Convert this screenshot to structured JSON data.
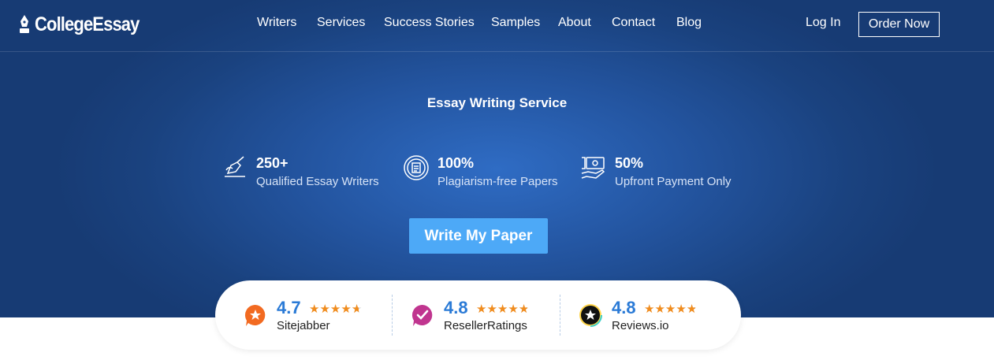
{
  "header": {
    "logo_text": "CollegeEssay",
    "nav": [
      "Writers",
      "Services",
      "Success Stories",
      "Samples",
      "About",
      "Contact",
      "Blog"
    ],
    "login_label": "Log In",
    "order_label": "Order Now"
  },
  "hero": {
    "title": "Essay Writing Service",
    "stats": [
      {
        "icon": "writing-hand-icon",
        "value": "250+",
        "label": "Qualified Essay Writers"
      },
      {
        "icon": "certified-document-icon",
        "value": "100%",
        "label": "Plagiarism-free Papers"
      },
      {
        "icon": "hand-money-icon",
        "value": "50%",
        "label": "Upfront Payment Only"
      }
    ],
    "cta_label": "Write My Paper"
  },
  "ratings": [
    {
      "score": "4.7",
      "stars": 4.7,
      "name": "Sitejabber",
      "icon": "sitejabber-icon",
      "color": "#f26a21"
    },
    {
      "score": "4.8",
      "stars": 4.8,
      "name": "ResellerRatings",
      "icon": "resellerratings-icon",
      "color": "#c0358f"
    },
    {
      "score": "4.8",
      "stars": 4.8,
      "name": "Reviews.io",
      "icon": "reviews-io-icon",
      "color": "#111111"
    }
  ],
  "colors": {
    "hero_bg": "#23549f",
    "cta_bg": "#4da9f7",
    "score_text": "#2a7ad6",
    "stars": "#f08c1e"
  }
}
